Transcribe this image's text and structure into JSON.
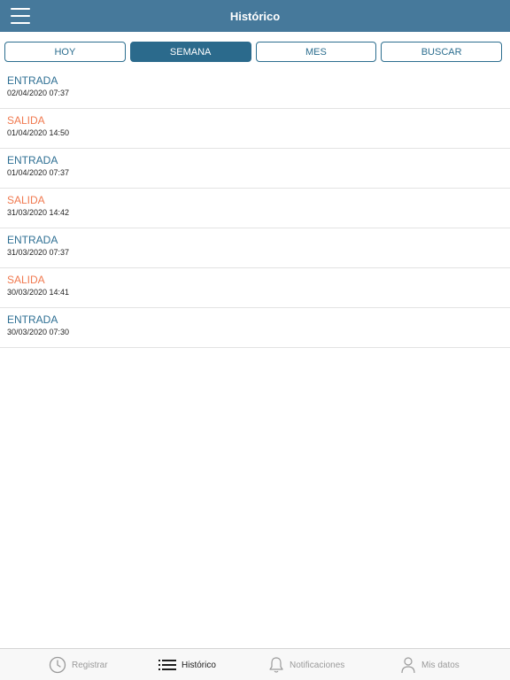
{
  "header": {
    "title": "Histórico",
    "menu_icon": "hamburger-menu-icon"
  },
  "tabs": [
    {
      "label": "HOY",
      "active": false
    },
    {
      "label": "SEMANA",
      "active": true
    },
    {
      "label": "MES",
      "active": false
    },
    {
      "label": "BUSCAR",
      "active": false
    }
  ],
  "records": [
    {
      "type": "ENTRADA",
      "datetime": "02/04/2020 07:37"
    },
    {
      "type": "SALIDA",
      "datetime": "01/04/2020 14:50"
    },
    {
      "type": "ENTRADA",
      "datetime": "01/04/2020 07:37"
    },
    {
      "type": "SALIDA",
      "datetime": "31/03/2020 14:42"
    },
    {
      "type": "ENTRADA",
      "datetime": "31/03/2020 07:37"
    },
    {
      "type": "SALIDA",
      "datetime": "30/03/2020 14:41"
    },
    {
      "type": "ENTRADA",
      "datetime": "30/03/2020 07:30"
    }
  ],
  "tabbar": [
    {
      "label": "Registrar",
      "icon": "clock-icon",
      "active": false
    },
    {
      "label": "Histórico",
      "icon": "list-icon",
      "active": true
    },
    {
      "label": "Notificaciones",
      "icon": "bell-icon",
      "active": false
    },
    {
      "label": "Mis datos",
      "icon": "user-icon",
      "active": false
    }
  ],
  "colors": {
    "header_bg": "#46799b",
    "tab_active": "#2b6a8c",
    "entrada": "#2e6f93",
    "salida": "#f0794f"
  }
}
